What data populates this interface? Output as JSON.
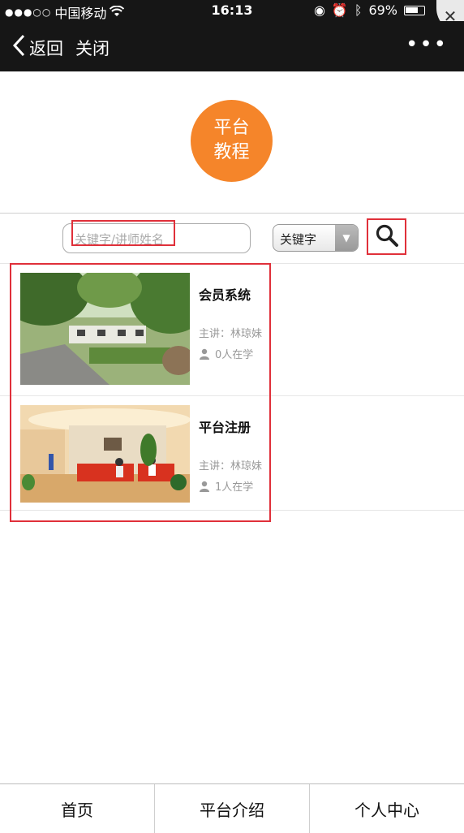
{
  "status_bar": {
    "carrier": "中国移动",
    "time": "16:13",
    "battery": "69%"
  },
  "nav": {
    "back_label": "返回",
    "close_label": "关闭",
    "more_label": "•••"
  },
  "hero": {
    "line1": "平台",
    "line2": "教程",
    "color": "#f5852a"
  },
  "search": {
    "placeholder": "关键字/讲师姓名",
    "select_value": "关键字"
  },
  "courses": [
    {
      "title": "会员系统",
      "teacher": "主讲：林琼妹",
      "learners": "0人在学",
      "image": "garden-courtyard"
    },
    {
      "title": "平台注册",
      "teacher": "主讲：林琼妹",
      "learners": "1人在学",
      "image": "lobby-red-sofa"
    }
  ],
  "tabs": [
    {
      "label": "首页"
    },
    {
      "label": "平台介绍"
    },
    {
      "label": "个人中心"
    }
  ],
  "accent_colors": {
    "highlight_box": "#e0303a",
    "header_bg": "#161616"
  }
}
